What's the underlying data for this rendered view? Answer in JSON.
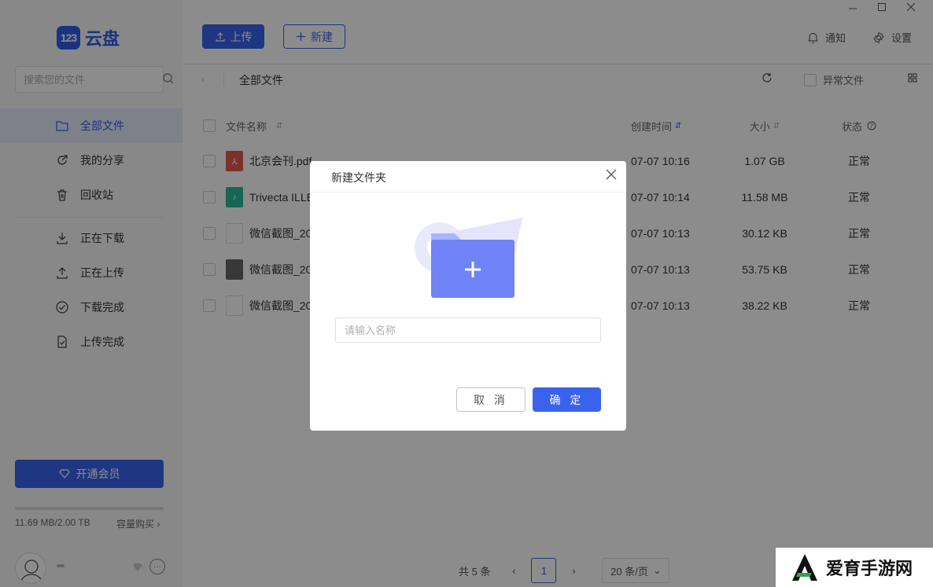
{
  "app": {
    "brand_mark": "123",
    "brand_text": "云盘"
  },
  "search": {
    "placeholder": "搜索您的文件"
  },
  "sidebar": {
    "items": [
      {
        "label": "全部文件",
        "icon": "folder-icon"
      },
      {
        "label": "我的分享",
        "icon": "share-icon"
      },
      {
        "label": "回收站",
        "icon": "trash-icon"
      },
      {
        "label": "正在下载",
        "icon": "download-icon"
      },
      {
        "label": "正在上传",
        "icon": "upload-icon"
      },
      {
        "label": "下载完成",
        "icon": "check-circle-icon"
      },
      {
        "label": "上传完成",
        "icon": "check-file-icon"
      }
    ],
    "vip_label": "开通会员",
    "storage_text": "11.69 MB/2.00 TB",
    "storage_fraction": 5.7e-06,
    "buy_label": "容量购买"
  },
  "toolbar": {
    "upload_label": "上传",
    "new_label": "新建",
    "notify_label": "通知",
    "settings_label": "设置"
  },
  "path": {
    "current": "全部文件",
    "abnormal_label": "异常文件"
  },
  "table": {
    "headers": {
      "name": "文件名称",
      "created": "创建时间",
      "size": "大小",
      "status": "状态"
    },
    "rows": [
      {
        "name": "北京会刊.pdf",
        "created": "07-07 10:16",
        "size": "1.07 GB",
        "status": "正常",
        "type": "pdf"
      },
      {
        "name": "Trivecta ILLE",
        "created": "07-07 10:14",
        "size": "11.58 MB",
        "status": "正常",
        "type": "audio"
      },
      {
        "name": "微信截图_20",
        "created": "07-07 10:13",
        "size": "30.12 KB",
        "status": "正常",
        "type": "image"
      },
      {
        "name": "微信截图_20",
        "created": "07-07 10:13",
        "size": "53.75 KB",
        "status": "正常",
        "type": "image-dark"
      },
      {
        "name": "微信截图_20",
        "created": "07-07 10:13",
        "size": "38.22 KB",
        "status": "正常",
        "type": "image"
      }
    ]
  },
  "pagination": {
    "total": "共 5 条",
    "page": "1",
    "page_size": "20 条/页"
  },
  "modal": {
    "title": "新建文件夹",
    "input_placeholder": "请输入名称",
    "cancel_label": "取 消",
    "ok_label": "确 定"
  },
  "watermark": {
    "text": "爱育手游网"
  },
  "colors": {
    "accent": "#3a63ed",
    "sidebar_bg": "#f7f8fa",
    "pdf": "#e25b4f",
    "audio": "#2cb89a"
  }
}
